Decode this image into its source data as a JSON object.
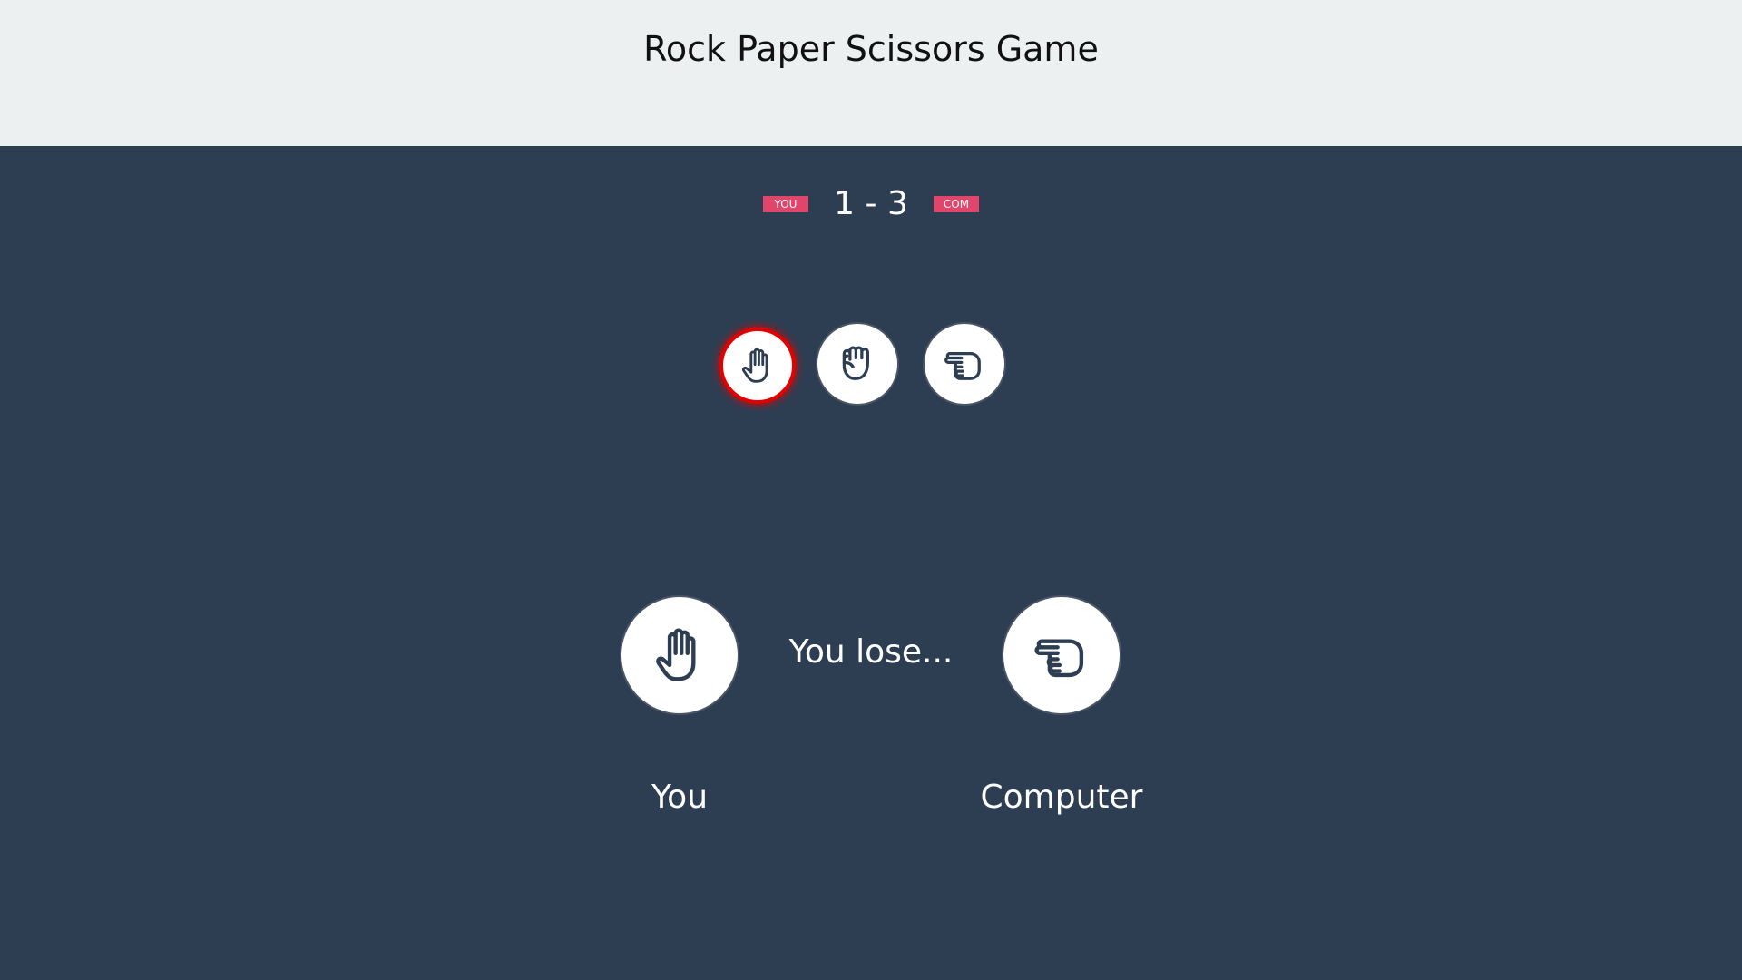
{
  "header": {
    "title": "Rock Paper Scissors Game"
  },
  "scoreboard": {
    "you_badge": "YOU",
    "com_badge": "COM",
    "score_text": "1 - 3",
    "you_score": 1,
    "com_score": 3
  },
  "choices": [
    {
      "name": "paper",
      "icon": "open-hand-icon",
      "selected": true
    },
    {
      "name": "rock",
      "icon": "fist-icon",
      "selected": false
    },
    {
      "name": "scissors",
      "icon": "scissors-hand-icon",
      "selected": false
    }
  ],
  "result": {
    "player_choice_icon": "open-hand-icon",
    "computer_choice_icon": "scissors-hand-icon",
    "message": "You lose...",
    "player_label": "You",
    "computer_label": "Computer"
  },
  "colors": {
    "background": "#2e3e52",
    "header_background": "#ecf0f1",
    "badge": "#e2456c",
    "selected_ring": "#e30000",
    "icon_stroke": "#2e3e52"
  }
}
